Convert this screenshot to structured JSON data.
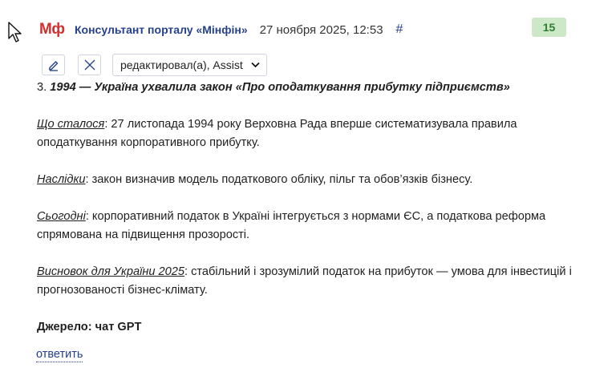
{
  "comment": {
    "logo_text": "Мф",
    "author": "Консультант порталу «Мінфін»",
    "date": "27 ноября 2025, 12:53",
    "anchor": "#",
    "score": "15",
    "toolbar": {
      "edit_icon": "pencil-icon",
      "delete_icon": "close-icon",
      "edited_by": "редактировал(а), Assist"
    },
    "headline_number": "3.",
    "headline": "1994 — Україна ухвалила закон «Про оподаткування прибутку підприємств»",
    "sections": [
      {
        "label": "Що сталося",
        "text": ": 27 листопада 1994 року Верховна Рада вперше систематизувала правила оподаткування корпоративного прибутку."
      },
      {
        "label": "Наслідки",
        "text": ": закон визначив модель податкового обліку, пільг та обов’язків бізнесу."
      },
      {
        "label": "Сьогодні",
        "text": ": корпоративний податок в Україні інтегрується з нормами ЄС, а податкова реформа спрямована на підвищення прозорості."
      },
      {
        "label": "Висновок для України 2025",
        "text": ": стабільний і зрозумілий податок на прибуток — умова для інвестицій і прогнозованості бізнес-клімату."
      }
    ],
    "source": "Джерело: чат GPT",
    "reply_label": "ответить"
  },
  "colors": {
    "brand_red": "#d32f2f",
    "link_blue": "#24408e",
    "score_bg": "#cde8c6",
    "score_text": "#2e7d32"
  }
}
